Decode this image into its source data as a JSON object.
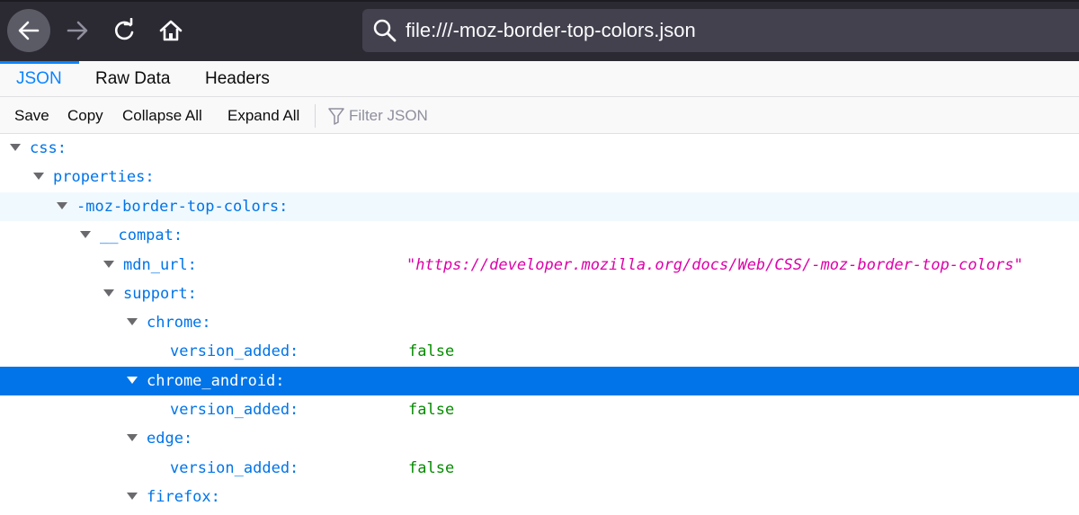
{
  "browser": {
    "url": "file:///-moz-border-top-colors.json",
    "icons": [
      "back-arrow-icon",
      "forward-arrow-icon",
      "reload-icon",
      "home-icon",
      "search-icon"
    ]
  },
  "tabs": [
    {
      "label": "JSON",
      "active": true
    },
    {
      "label": "Raw Data",
      "active": false
    },
    {
      "label": "Headers",
      "active": false
    }
  ],
  "json_toolbar": {
    "save": "Save",
    "copy": "Copy",
    "collapse_all": "Collapse All",
    "expand_all": "Expand All",
    "filter_placeholder": "Filter JSON"
  },
  "tree": [
    {
      "key": "css:",
      "depth": 0,
      "expanded": true
    },
    {
      "key": "properties:",
      "depth": 1,
      "expanded": true
    },
    {
      "key": "-moz-border-top-colors:",
      "depth": 2,
      "expanded": true,
      "state": "hover"
    },
    {
      "key": "__compat:",
      "depth": 3,
      "expanded": true
    },
    {
      "key": "mdn_url:",
      "depth": 4,
      "expanded": true,
      "value": "\"https://developer.mozilla.org/docs/Web/CSS/-moz-border-top-colors\"",
      "value_type": "string"
    },
    {
      "key": "support:",
      "depth": 4,
      "expanded": true
    },
    {
      "key": "chrome:",
      "depth": 5,
      "expanded": true
    },
    {
      "key": "version_added:",
      "depth": 6,
      "value": "false",
      "value_type": "boolean"
    },
    {
      "key": "chrome_android:",
      "depth": 5,
      "expanded": true,
      "state": "selected"
    },
    {
      "key": "version_added:",
      "depth": 6,
      "value": "false",
      "value_type": "boolean"
    },
    {
      "key": "edge:",
      "depth": 5,
      "expanded": true
    },
    {
      "key": "version_added:",
      "depth": 6,
      "value": "false",
      "value_type": "boolean"
    },
    {
      "key": "firefox:",
      "depth": 5,
      "expanded": true
    }
  ],
  "colors": {
    "accent": "#0a84ff",
    "key": "#0074e8",
    "boolean": "#058b00",
    "string": "#dd00a9",
    "selected_row": "#0074e8"
  }
}
